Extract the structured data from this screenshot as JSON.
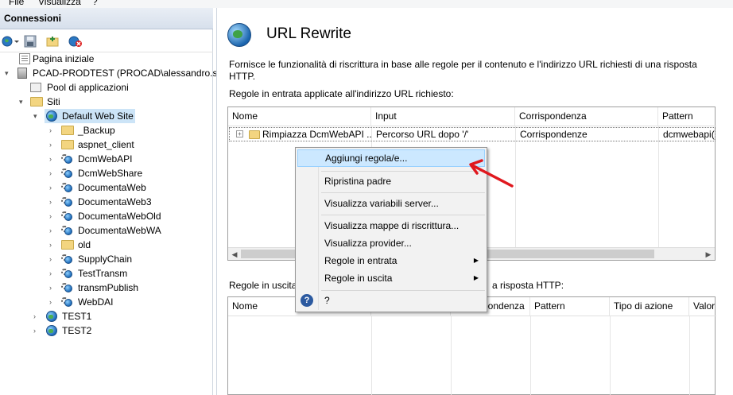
{
  "menubar": {
    "items": [
      "File",
      "Visualizza",
      "?"
    ]
  },
  "connections": {
    "title": "Connessioni",
    "tree": [
      {
        "label": "Pagina iniziale",
        "icon": "start-page-icon"
      },
      {
        "label": "PCAD-PRODTEST (PROCAD\\alessandro.sgr",
        "icon": "server-icon"
      },
      {
        "label": "Pool di applicazioni",
        "icon": "app-pool-icon"
      },
      {
        "label": "Siti",
        "icon": "sites-folder-icon"
      },
      {
        "label": "Default Web Site",
        "icon": "globe-icon"
      },
      {
        "label": "_Backup",
        "icon": "folder-icon"
      },
      {
        "label": "aspnet_client",
        "icon": "folder-icon"
      },
      {
        "label": "DcmWebAPI",
        "icon": "web-app-icon"
      },
      {
        "label": "DcmWebShare",
        "icon": "web-app-icon"
      },
      {
        "label": "DocumentaWeb",
        "icon": "web-app-icon"
      },
      {
        "label": "DocumentaWeb3",
        "icon": "web-app-icon"
      },
      {
        "label": "DocumentaWebOld",
        "icon": "web-app-icon"
      },
      {
        "label": "DocumentaWebWA",
        "icon": "web-app-icon"
      },
      {
        "label": "old",
        "icon": "folder-icon"
      },
      {
        "label": "SupplyChain",
        "icon": "web-app-icon"
      },
      {
        "label": "TestTransm",
        "icon": "web-app-icon"
      },
      {
        "label": "transmPublish",
        "icon": "web-app-icon"
      },
      {
        "label": "WebDAI",
        "icon": "web-app-icon"
      },
      {
        "label": "TEST1",
        "icon": "globe-icon"
      },
      {
        "label": "TEST2",
        "icon": "globe-icon"
      }
    ]
  },
  "main": {
    "title": "URL Rewrite",
    "description": "Fornisce le funzionalità di riscrittura in base alle regole per il contenuto e l'indirizzo URL richiesti di una risposta HTTP.",
    "inbound_label": "Regole in entrata applicate all'indirizzo URL richiesto:",
    "inbound_columns": [
      "Nome",
      "Input",
      "Corrispondenza",
      "Pattern"
    ],
    "inbound_rows": [
      {
        "name": "Rimpiazza DcmWebAPI ...",
        "input": "Percorso URL dopo '/'",
        "match": "Corrispondenze",
        "pattern": "dcmwebapi("
      }
    ],
    "outbound_label_left": "Regole in uscita",
    "outbound_label_right": "a risposta HTTP:",
    "outbound_columns": [
      "Nome",
      "spondenza",
      "Pattern",
      "Tipo di azione",
      "Valor"
    ]
  },
  "context_menu": {
    "items": [
      {
        "label": "Aggiungi regola/e...",
        "highlighted": true
      },
      {
        "label": "Ripristina padre"
      },
      {
        "label": "Visualizza variabili server..."
      },
      {
        "label": "Visualizza mappe di riscrittura..."
      },
      {
        "label": "Visualizza provider..."
      },
      {
        "label": "Regole in entrata",
        "submenu": true
      },
      {
        "label": "Regole in uscita",
        "submenu": true
      },
      {
        "label": "?"
      }
    ]
  },
  "colors": {
    "selection": "#cce4f7",
    "menu_highlight": "#cce8ff",
    "annotation_arrow": "#e0181e"
  }
}
